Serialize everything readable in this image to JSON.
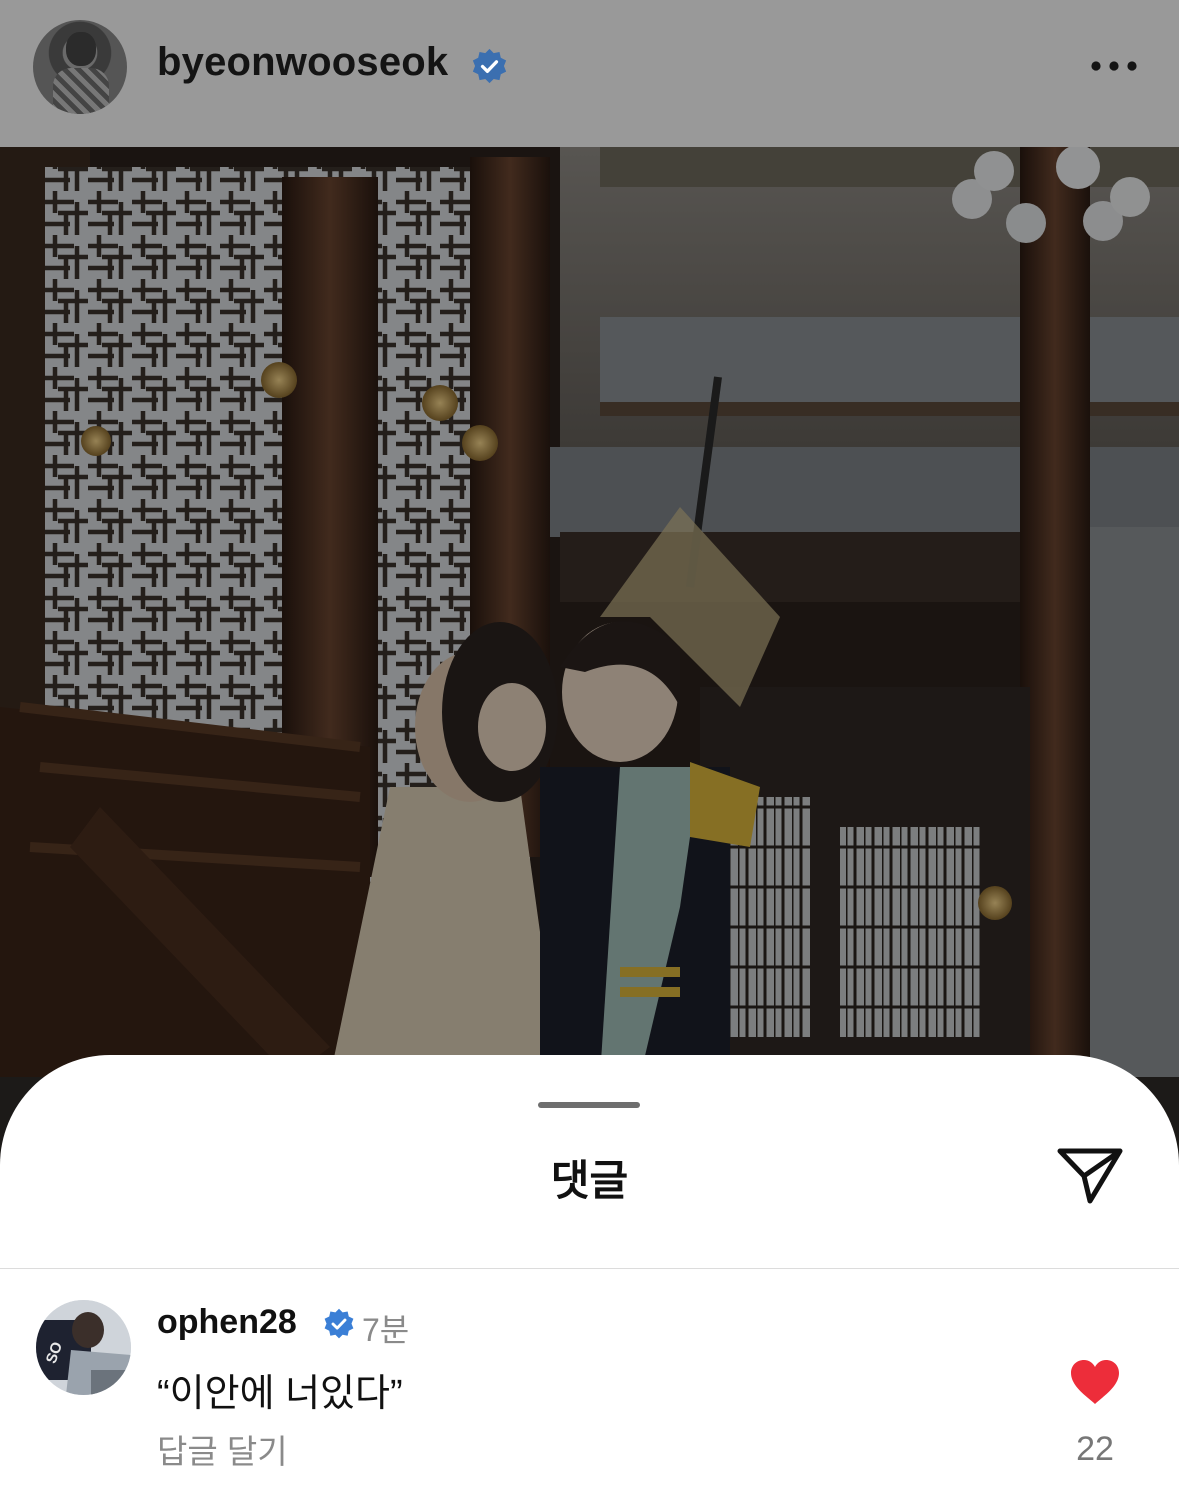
{
  "post": {
    "username": "byeonwooseok",
    "verified": true,
    "avatar_icon": "profile-photo",
    "more_icon": "more-horizontal-icon"
  },
  "photo": {
    "kind": "post-image"
  },
  "comments_sheet": {
    "title": "댓글",
    "share_icon": "send-icon",
    "comments": [
      {
        "username": "ophen28",
        "verified": true,
        "time": "7분",
        "text": "“이안에 너있다”",
        "reply_label": "답글 달기",
        "liked": true,
        "like_count": "22"
      }
    ]
  },
  "colors": {
    "verified_blue": "#3b7fd6",
    "like_red": "#ed2d3a",
    "dim_overlay": "#999999"
  }
}
